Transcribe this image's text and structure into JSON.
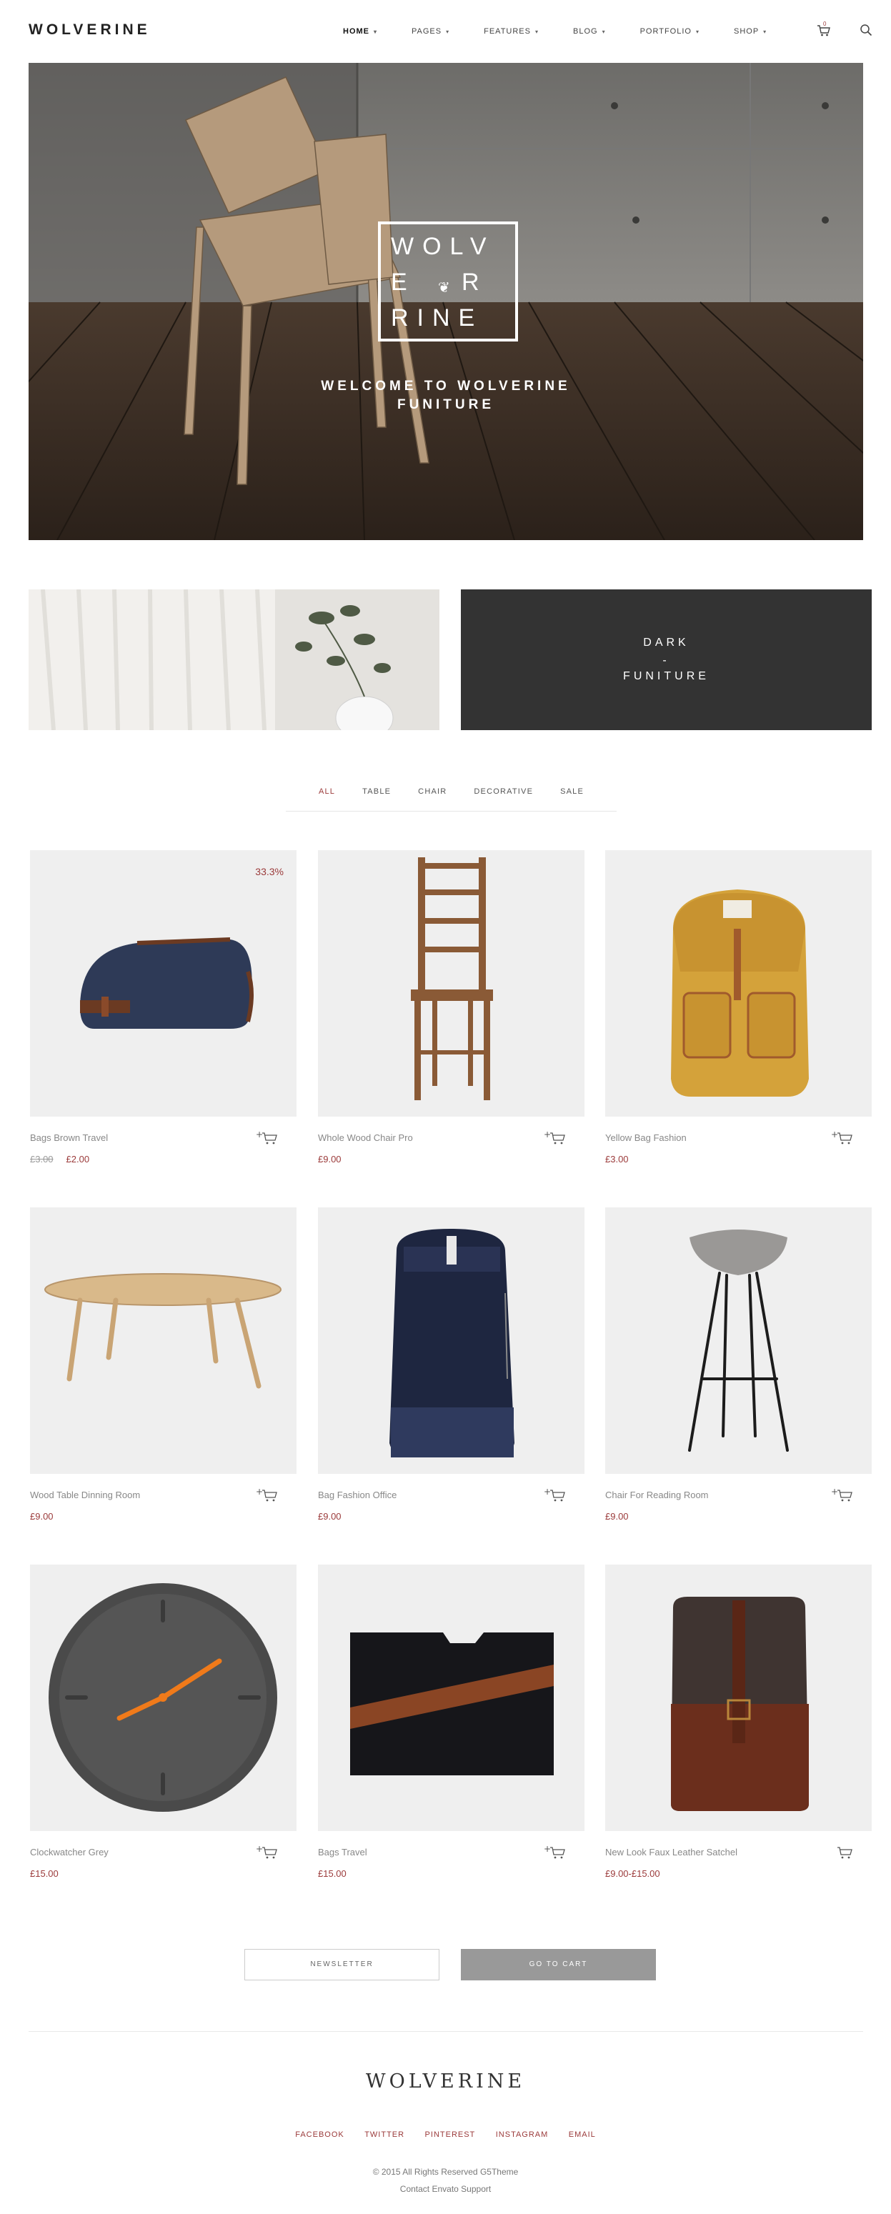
{
  "header": {
    "logo": "WOLVERINE",
    "nav": [
      {
        "label": "HOME",
        "active": true
      },
      {
        "label": "PAGES",
        "active": false
      },
      {
        "label": "FEATURES",
        "active": false
      },
      {
        "label": "BLOG",
        "active": false
      },
      {
        "label": "PORTFOLIO",
        "active": false
      },
      {
        "label": "SHOP",
        "active": false
      }
    ],
    "cart_count": "0",
    "icons": [
      "cart-icon",
      "search-icon"
    ]
  },
  "hero": {
    "logo_lines": [
      "WOLV",
      "E   R",
      "RINE"
    ],
    "welcome_line1": "WELCOME TO WOLVERINE",
    "welcome_line2": "FUNITURE"
  },
  "banners": {
    "dark_line1": "DARK",
    "dark_sep": "-",
    "dark_line2": "FUNITURE"
  },
  "filters": [
    "ALL",
    "TABLE",
    "CHAIR",
    "DECORATIVE",
    "SALE"
  ],
  "products": [
    {
      "name": "Bags Brown Travel",
      "old_price": "£3.00",
      "price": "£2.00",
      "badge": "33.3%"
    },
    {
      "name": "Whole Wood Chair Pro",
      "price": "£9.00"
    },
    {
      "name": "Yellow Bag Fashion",
      "price": "£3.00"
    },
    {
      "name": "Wood Table Dinning Room",
      "price": "£9.00"
    },
    {
      "name": "Bag Fashion Office",
      "price": "£9.00"
    },
    {
      "name": "Chair For Reading Room",
      "price": "£9.00"
    },
    {
      "name": "Clockwatcher Grey",
      "price": "£15.00"
    },
    {
      "name": "Bags Travel",
      "price": "£15.00"
    },
    {
      "name": "New Look Faux Leather Satchel",
      "price": "£9.00-£15.00"
    }
  ],
  "buttons": {
    "newsletter": "NEWSLETTER",
    "go_to_cart": "GO TO CART"
  },
  "footer": {
    "logo": "WOLVERINE",
    "social": [
      "FACEBOOK",
      "TWITTER",
      "PINTEREST",
      "INSTAGRAM",
      "EMAIL"
    ],
    "copyright": "© 2015 All Rights Reserved G5Theme",
    "support": "Contact Envato Support"
  },
  "colors": {
    "accent": "#9b3a3a",
    "dark_banner": "#333333",
    "cart_button": "#999999"
  }
}
